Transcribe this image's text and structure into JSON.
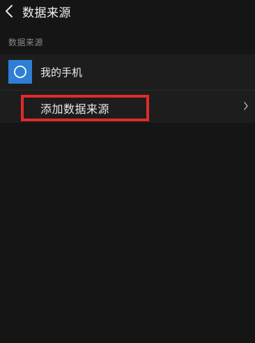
{
  "header": {
    "title": "数据来源",
    "back_icon": "chevron-left-icon"
  },
  "section": {
    "label": "数据来源"
  },
  "sources": {
    "phone": {
      "label": "我的手机",
      "icon": "circle-icon",
      "icon_color": "#2f7fd4"
    },
    "add": {
      "label": "添加数据来源",
      "icon": "chevron-right-icon"
    }
  },
  "colors": {
    "background": "#151515",
    "list_background": "#1d1d1d",
    "highlight": "#e02a2a"
  }
}
